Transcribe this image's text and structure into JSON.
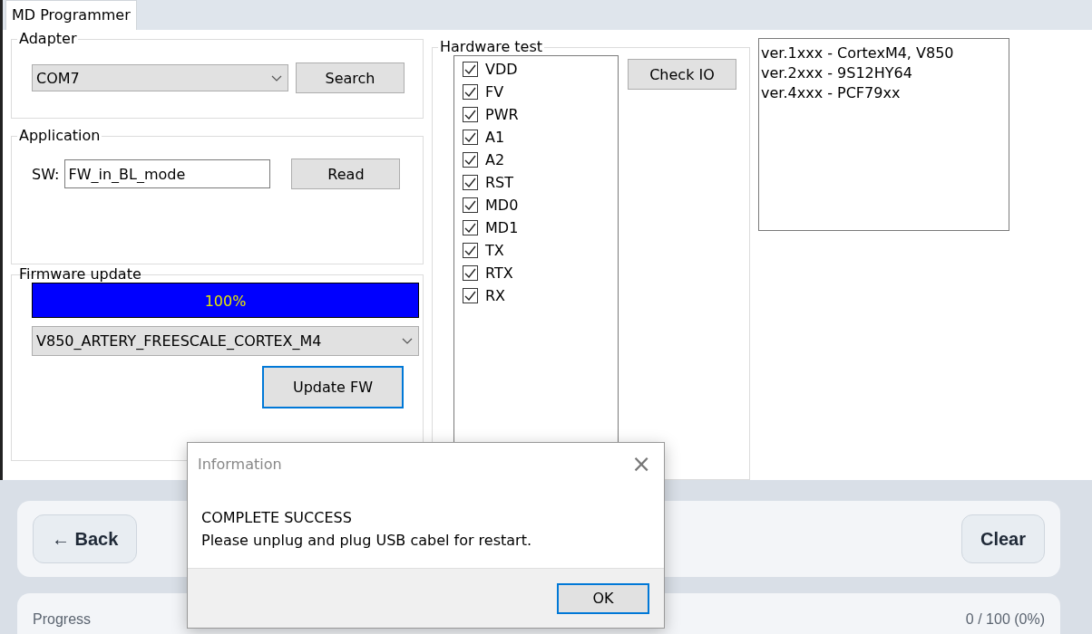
{
  "tabs": [
    {
      "label": "MD Programmer",
      "selected": true
    }
  ],
  "adapter": {
    "title": "Adapter",
    "port": "COM7",
    "button": "Search"
  },
  "application": {
    "title": "Application",
    "sw_label": "SW:",
    "sw_value": "FW_in_BL_mode",
    "button": "Read"
  },
  "firmware_update": {
    "title": "Firmware update",
    "progress": {
      "level": 1,
      "label": "100%"
    },
    "target": "V850_ARTERY_FREESCALE_CORTEX_M4",
    "button": "Update FW"
  },
  "hardware_test": {
    "title": "Hardware test",
    "button": "Check IO",
    "signals": [
      {
        "label": "VDD",
        "checked": true
      },
      {
        "label": "FV",
        "checked": true
      },
      {
        "label": "PWR",
        "checked": true
      },
      {
        "label": "A1",
        "checked": true
      },
      {
        "label": "A2",
        "checked": true
      },
      {
        "label": "RST",
        "checked": true
      },
      {
        "label": "MD0",
        "checked": true
      },
      {
        "label": "MD1",
        "checked": true
      },
      {
        "label": "TX",
        "checked": true
      },
      {
        "label": "RTX",
        "checked": true
      },
      {
        "label": "RX",
        "checked": true
      }
    ]
  },
  "versions": [
    "ver.1xxx - CortexM4, V850",
    "ver.2xxx - 9S12HY64",
    "ver.4xxx - PCF79xx"
  ],
  "actions": {
    "back": "← Back",
    "clear": "Clear"
  },
  "progress_card": {
    "label": "Progress",
    "value": "0 / 100 (0%)"
  },
  "dialog": {
    "title": "Information",
    "close": "×",
    "lines": [
      "COMPLETE SUCCESS",
      "Please unplug and plug USB cabel for restart."
    ],
    "button": "OK"
  }
}
